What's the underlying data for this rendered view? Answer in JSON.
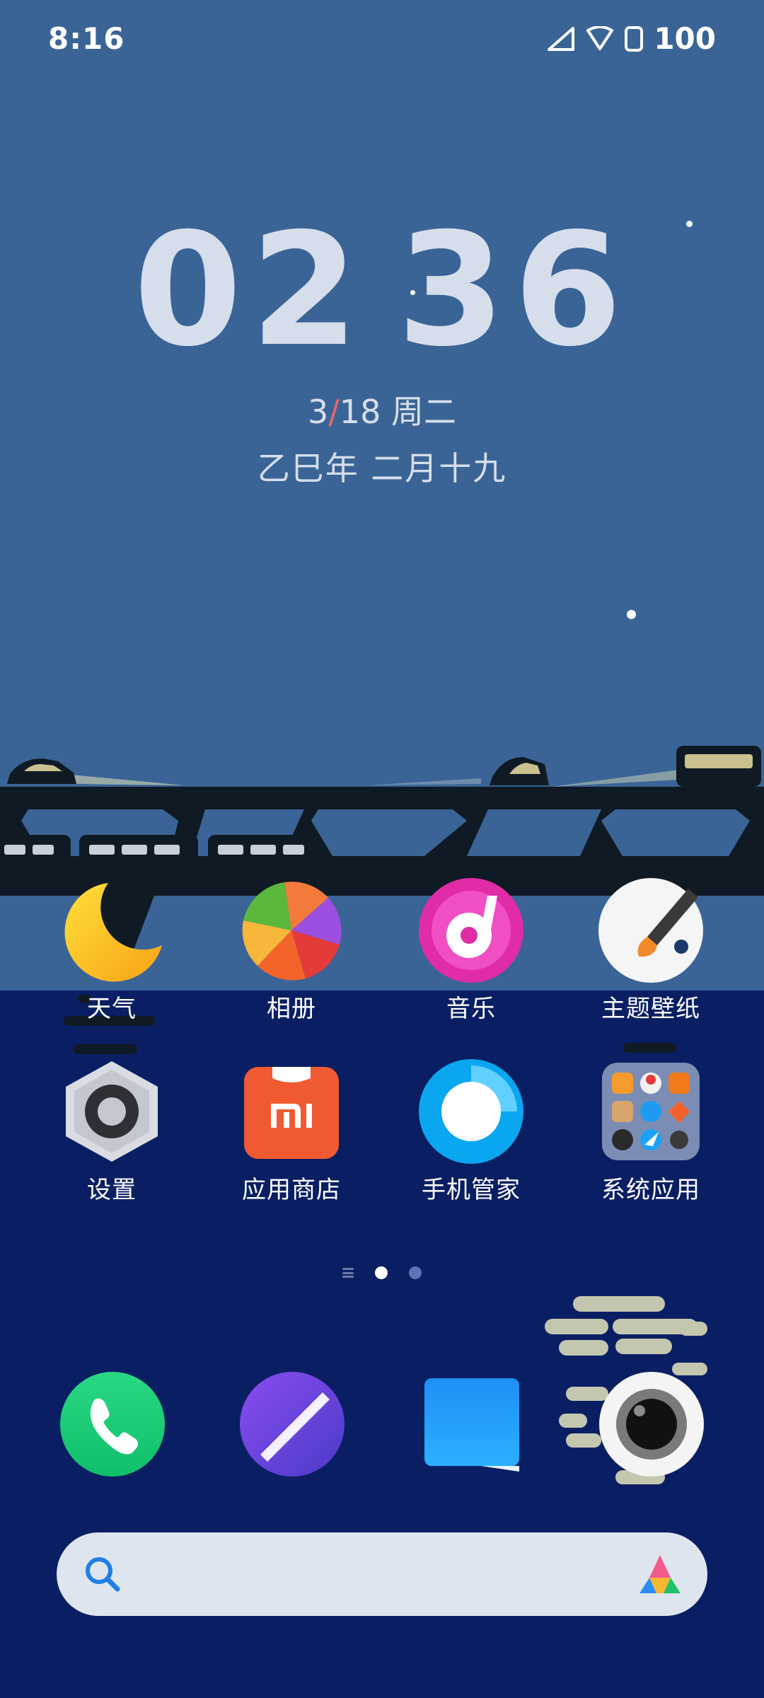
{
  "status_bar": {
    "time": "8:16",
    "battery_level": "100",
    "icons": [
      "signal-icon",
      "wifi-icon",
      "battery-icon"
    ]
  },
  "clock_widget": {
    "hour": "02",
    "minute": "36",
    "date_month": "3",
    "date_day": "18",
    "weekday": "周二",
    "lunar": "乙巳年 二月十九"
  },
  "apps": [
    {
      "label": "天气",
      "icon": "weather-icon"
    },
    {
      "label": "相册",
      "icon": "gallery-icon"
    },
    {
      "label": "音乐",
      "icon": "music-icon"
    },
    {
      "label": "主题壁纸",
      "icon": "themes-icon"
    },
    {
      "label": "设置",
      "icon": "settings-icon"
    },
    {
      "label": "应用商店",
      "icon": "app-store-icon"
    },
    {
      "label": "手机管家",
      "icon": "security-icon"
    },
    {
      "label": "系统应用",
      "icon": "system-apps-folder-icon"
    }
  ],
  "pager": {
    "pages": 2,
    "active_index": 0
  },
  "dock": [
    {
      "icon": "phone-icon"
    },
    {
      "icon": "browser-icon"
    },
    {
      "icon": "messages-icon"
    },
    {
      "icon": "camera-icon"
    }
  ],
  "search_bar": {
    "icon": "search-icon",
    "assistant_icon": "assistant-icon"
  },
  "colors": {
    "sky": "#3a6496",
    "ground": "#0a1f63",
    "clock_text": "#d6deeb",
    "date_slash": "#e06a6a"
  }
}
